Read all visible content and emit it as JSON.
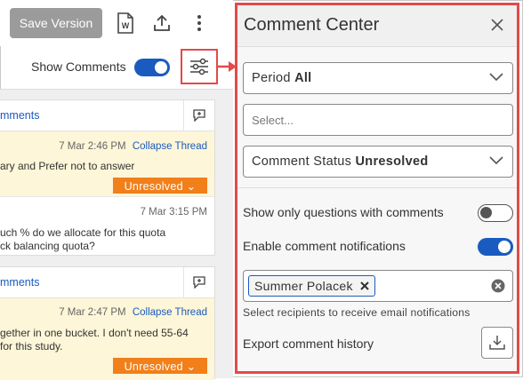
{
  "toolbar": {
    "save_label": "Save Version",
    "word_icon_letter": "W",
    "show_comments_label": "Show Comments",
    "show_comments_on": true
  },
  "threads": [
    {
      "link": "mments",
      "comments": [
        {
          "timestamp": "7 Mar 2:46 PM",
          "collapse": "Collapse Thread",
          "lines": [
            "ary and Prefer not to answer"
          ],
          "status": "Unresolved ⌄"
        },
        {
          "timestamp": "7 Mar 3:15 PM",
          "lines": [
            "uch % do we allocate for this quota",
            "ck balancing quota?"
          ]
        }
      ]
    },
    {
      "link": "mments",
      "comments": [
        {
          "timestamp": "7 Mar 2:47 PM",
          "collapse": "Collapse Thread",
          "lines": [
            "gether in one bucket. I don't need 55-64",
            " for this study."
          ],
          "status": "Unresolved ⌄"
        }
      ]
    }
  ],
  "panel": {
    "title": "Comment Center",
    "period": {
      "label": "Period",
      "value": "All"
    },
    "select_placeholder": "Select...",
    "status": {
      "label": "Comment Status",
      "value": "Unresolved"
    },
    "only_questions_label": "Show only questions with comments",
    "only_questions_on": false,
    "notifications_label": "Enable comment notifications",
    "notifications_on": true,
    "recipient_chip": "Summer Polacek",
    "recipients_hint": "Select recipients to receive email notifications",
    "export_label": "Export comment history"
  },
  "colors": {
    "accent_blue": "#1a5bbf",
    "highlight_red": "#e34a4a",
    "badge_orange": "#f17f1a",
    "comment_yellow": "#fdf6d8"
  },
  "icons": [
    "word-doc-icon",
    "share-upload-icon",
    "more-vert-icon",
    "filter-sliders-icon",
    "arrow-right-icon",
    "add-comment-icon",
    "close-icon",
    "chevron-down-icon",
    "chip-remove-icon",
    "clear-all-icon",
    "download-icon"
  ]
}
